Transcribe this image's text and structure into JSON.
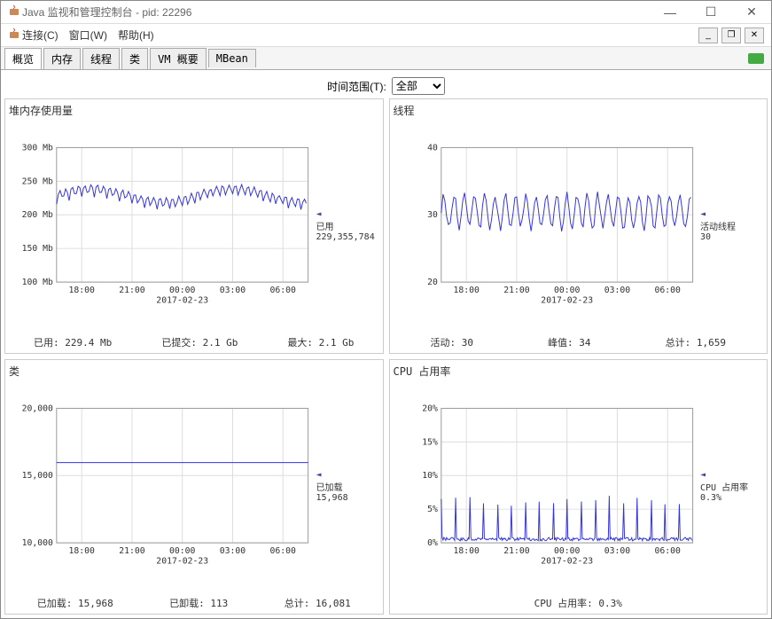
{
  "window": {
    "title": "Java 监视和管理控制台 - pid: 22296"
  },
  "menu": {
    "connect": "连接(C)",
    "window": "窗口(W)",
    "help": "帮助(H)"
  },
  "tabs": {
    "overview": "概览",
    "memory": "内存",
    "threads": "线程",
    "classes": "类",
    "vm": "VM 概要",
    "mbean": "MBean"
  },
  "timerange": {
    "label": "时间范围(T):",
    "value": "全部"
  },
  "panels": {
    "heap": {
      "title": "堆内存使用量",
      "legend_label": "已用",
      "legend_value": "229,355,784",
      "stats": {
        "used_label": "已用:",
        "used_value": "229.4  Mb",
        "committed_label": "已提交:",
        "committed_value": "2.1  Gb",
        "max_label": "最大:",
        "max_value": "2.1  Gb"
      }
    },
    "threads": {
      "title": "线程",
      "legend_label": "活动线程",
      "legend_value": "30",
      "stats": {
        "live_label": "活动:",
        "live_value": "30",
        "peak_label": "峰值:",
        "peak_value": "34",
        "total_label": "总计:",
        "total_value": "1,659"
      }
    },
    "classes": {
      "title": "类",
      "legend_label": "已加载",
      "legend_value": "15,968",
      "stats": {
        "loaded_label": "已加载:",
        "loaded_value": "15,968",
        "unloaded_label": "已卸载:",
        "unloaded_value": "113",
        "total_label": "总计:",
        "total_value": "16,081"
      }
    },
    "cpu": {
      "title": "CPU 占用率",
      "legend_label": "CPU 占用率",
      "legend_value": "0.3%",
      "stats": {
        "cpu_label": "CPU 占用率:",
        "cpu_value": "0.3%"
      }
    }
  },
  "chart_data": [
    {
      "type": "line",
      "title": "堆内存使用量",
      "ylabel": "Mb",
      "ylim": [
        100,
        300
      ],
      "yticks": [
        100,
        150,
        200,
        250,
        300
      ],
      "ytick_labels": [
        "100 Mb",
        "150 Mb",
        "200 Mb",
        "250 Mb",
        "300 Mb"
      ],
      "xticks": [
        "18:00",
        "21:00",
        "00:00",
        "03:00",
        "06:00"
      ],
      "xlabel": "2017-02-23",
      "series": [
        {
          "name": "已用",
          "oscillates_between": [
            200,
            245
          ],
          "current": 229
        }
      ]
    },
    {
      "type": "line",
      "title": "线程",
      "ylim": [
        20,
        40
      ],
      "yticks": [
        20,
        30,
        40
      ],
      "xticks": [
        "18:00",
        "21:00",
        "00:00",
        "03:00",
        "06:00"
      ],
      "xlabel": "2017-02-23",
      "series": [
        {
          "name": "活动线程",
          "oscillates_between": [
            28,
            33
          ],
          "current": 30
        }
      ]
    },
    {
      "type": "line",
      "title": "类",
      "ylim": [
        10000,
        20000
      ],
      "yticks": [
        10000,
        15000,
        20000
      ],
      "ytick_labels": [
        "10,000",
        "15,000",
        "20,000"
      ],
      "xticks": [
        "18:00",
        "21:00",
        "00:00",
        "03:00",
        "06:00"
      ],
      "xlabel": "2017-02-23",
      "series": [
        {
          "name": "已加载",
          "flat_at": 15968
        }
      ]
    },
    {
      "type": "line",
      "title": "CPU 占用率",
      "ylabel": "%",
      "ylim": [
        0,
        20
      ],
      "yticks": [
        0,
        5,
        10,
        15,
        20
      ],
      "ytick_labels": [
        "0%",
        "5%",
        "10%",
        "15%",
        "20%"
      ],
      "xticks": [
        "18:00",
        "21:00",
        "00:00",
        "03:00",
        "06:00"
      ],
      "xlabel": "2017-02-23",
      "series": [
        {
          "name": "CPU 占用率",
          "baseline": 0.3,
          "spikes_to": 7,
          "spike_count": 18
        }
      ]
    }
  ]
}
